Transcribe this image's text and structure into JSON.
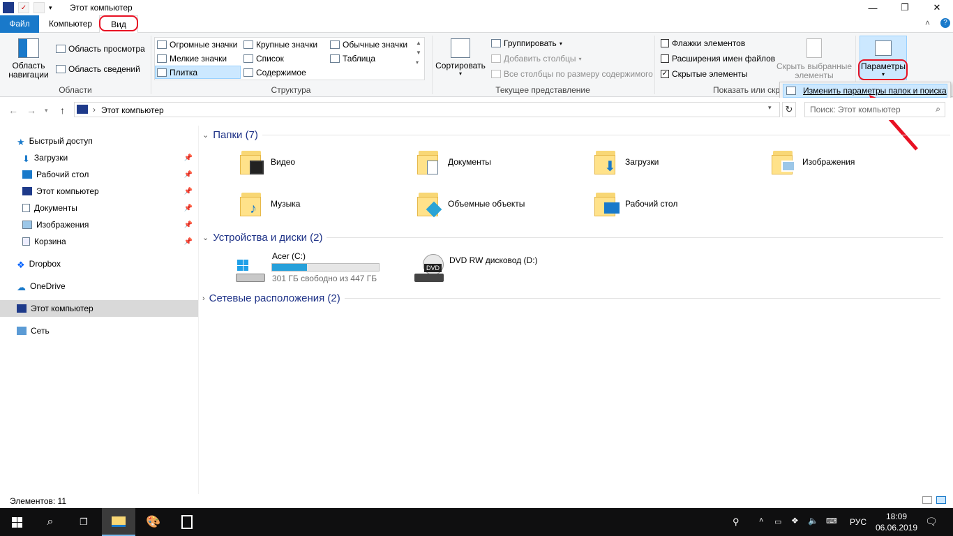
{
  "window": {
    "title": "Этот компьютер",
    "minimize": "—",
    "restore": "❐",
    "close": "✕",
    "collapse_ribbon": "˄",
    "help": "?"
  },
  "tabs": {
    "file": "Файл",
    "computer": "Компьютер",
    "view": "Вид"
  },
  "ribbon": {
    "areas": {
      "label": "Области",
      "nav_pane": "Область навигации",
      "preview_pane": "Область просмотра",
      "details_pane": "Область сведений"
    },
    "layout": {
      "label": "Структура",
      "items": [
        "Огромные значки",
        "Крупные значки",
        "Обычные значки",
        "Мелкие значки",
        "Список",
        "Таблица",
        "Плитка",
        "Содержимое"
      ]
    },
    "current_view": {
      "label": "Текущее представление",
      "sort": "Сортировать",
      "group": "Группировать",
      "add_columns": "Добавить столбцы",
      "fit_columns": "Все столбцы по размеру содержимого"
    },
    "show_hide": {
      "label": "Показать или скр",
      "item_checkboxes": "Флажки элементов",
      "extensions": "Расширения имен файлов",
      "hidden_items": "Скрытые элементы",
      "hide_selected": "Скрыть выбранные элементы"
    },
    "options": {
      "label": "Параметры",
      "menu_item": "Изменить параметры папок и поиска"
    }
  },
  "address": {
    "path": "Этот компьютер",
    "search_placeholder": "Поиск: Этот компьютер"
  },
  "sidebar": {
    "quick_access": "Быстрый доступ",
    "items": [
      "Загрузки",
      "Рабочий стол",
      "Этот компьютер",
      "Документы",
      "Изображения",
      "Корзина"
    ],
    "dropbox": "Dropbox",
    "onedrive": "OneDrive",
    "this_pc": "Этот компьютер",
    "network": "Сеть"
  },
  "main": {
    "folders_header": "Папки (7)",
    "folders": [
      "Видео",
      "Документы",
      "Загрузки",
      "Изображения",
      "Музыка",
      "Объемные объекты",
      "Рабочий стол"
    ],
    "devices_header": "Устройства и диски (2)",
    "drive_c": {
      "name": "Acer (C:)",
      "free": "301 ГБ свободно из 447 ГБ",
      "used_fraction": 0.33
    },
    "drive_d": {
      "name": "DVD RW дисковод (D:)",
      "badge": "DVD"
    },
    "network_header": "Сетевые расположения (2)"
  },
  "status": {
    "count": "Элементов: 11"
  },
  "taskbar": {
    "lang": "РУС",
    "time": "18:09",
    "date": "06.06.2019"
  },
  "colors": {
    "accent": "#1979ca",
    "highlight": "#cce8ff",
    "red": "#e81123"
  }
}
